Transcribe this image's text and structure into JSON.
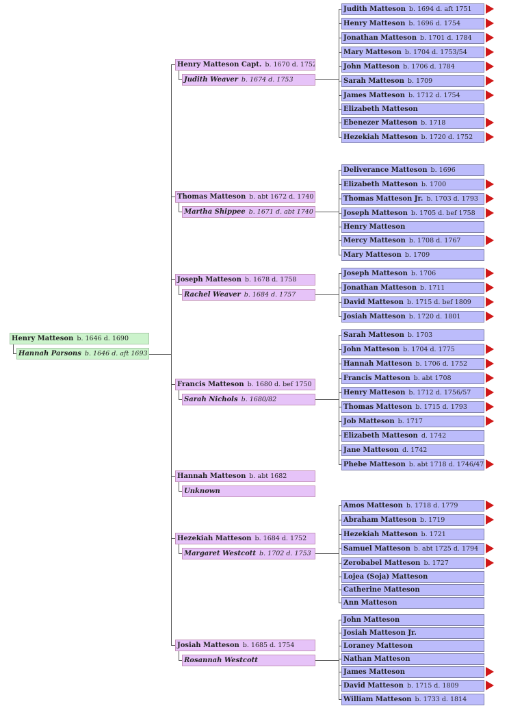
{
  "root": {
    "name": "Henry Matteson",
    "dates": "b. 1646 d. 1690",
    "spouse": "Hannah Parsons",
    "spouse_dates": "b. 1646 d. aft 1693"
  },
  "colors": {
    "root": "#ccf3cc",
    "parent": "#e6c3f8",
    "child": "#bcbcfb",
    "arrow": "#d01818"
  },
  "families": [
    {
      "name": "Henry Matteson Capt.",
      "dates": "b. 1670 d. 1752",
      "spouse": "Judith Weaver",
      "spouse_dates": "b. 1674 d. 1753",
      "children": [
        {
          "name": "Judith Matteson",
          "dates": "b. 1694 d. aft 1751",
          "more": true
        },
        {
          "name": "Henry Matteson",
          "dates": "b. 1696 d. 1754",
          "more": true
        },
        {
          "name": "Jonathan Matteson",
          "dates": "b. 1701 d. 1784",
          "more": true
        },
        {
          "name": "Mary Matteson",
          "dates": "b. 1704 d. 1753/54",
          "more": true
        },
        {
          "name": "John Matteson",
          "dates": "b. 1706 d.  1784",
          "more": true
        },
        {
          "name": "Sarah Matteson",
          "dates": "b. 1709",
          "more": true
        },
        {
          "name": "James Matteson",
          "dates": "b. 1712 d. 1754",
          "more": true
        },
        {
          "name": "Elizabeth Matteson",
          "dates": "",
          "more": false
        },
        {
          "name": "Ebenezer Matteson",
          "dates": "b. 1718",
          "more": true
        },
        {
          "name": "Hezekiah Matteson",
          "dates": "b. 1720 d. 1752",
          "more": true
        }
      ]
    },
    {
      "name": "Thomas Matteson",
      "dates": "b. abt 1672 d. 1740",
      "spouse": "Martha Shippee",
      "spouse_dates": "b. 1671 d. abt 1740",
      "children": [
        {
          "name": "Deliverance Matteson",
          "dates": "b. 1696",
          "more": false
        },
        {
          "name": "Elizabeth Matteson",
          "dates": "b. 1700",
          "more": true
        },
        {
          "name": "Thomas Matteson Jr.",
          "dates": "b. 1703 d. 1793",
          "more": true
        },
        {
          "name": "Joseph Matteson",
          "dates": "b. 1705 d. bef 1758",
          "more": true
        },
        {
          "name": "Henry Matteson",
          "dates": "",
          "more": false
        },
        {
          "name": "Mercy Matteson",
          "dates": "b. 1708 d. 1767",
          "more": true
        },
        {
          "name": "Mary Matteson",
          "dates": "b. 1709",
          "more": false
        }
      ]
    },
    {
      "name": "Joseph Matteson",
      "dates": "b. 1678 d. 1758",
      "spouse": "Rachel Weaver",
      "spouse_dates": "b. 1684 d. 1757",
      "children": [
        {
          "name": "Joseph Matteson",
          "dates": "b. 1706",
          "more": true
        },
        {
          "name": "Jonathan Matteson",
          "dates": "b. 1711",
          "more": true
        },
        {
          "name": "David Matteson",
          "dates": "b. 1715 d. bef 1809",
          "more": true
        },
        {
          "name": "Josiah Matteson",
          "dates": "b. 1720 d. 1801",
          "more": true
        }
      ]
    },
    {
      "name": "Francis Matteson",
      "dates": "b. 1680 d. bef 1750",
      "spouse": "Sarah Nichols",
      "spouse_dates": "b. 1680/82",
      "children": [
        {
          "name": "Sarah Matteson",
          "dates": "b. 1703",
          "more": false
        },
        {
          "name": "John Matteson",
          "dates": "b. 1704 d. 1775",
          "more": true
        },
        {
          "name": "Hannah Matteson",
          "dates": "b. 1706 d. 1752",
          "more": true
        },
        {
          "name": "Francis Matteson",
          "dates": "b. abt 1708",
          "more": true
        },
        {
          "name": "Henry Matteson",
          "dates": "b. 1712 d. 1756/57",
          "more": true
        },
        {
          "name": "Thomas Matteson",
          "dates": "b. 1715 d. 1793",
          "more": true
        },
        {
          "name": "Job Matteson",
          "dates": "b. 1717",
          "more": true
        },
        {
          "name": "Elizabeth Matteson",
          "dates": "d. 1742",
          "more": false
        },
        {
          "name": "Jane Matteson",
          "dates": "d. 1742",
          "more": false
        },
        {
          "name": "Phebe Matteson",
          "dates": "b. abt 1718 d. 1746/47",
          "more": true
        }
      ]
    },
    {
      "name": "Hannah Matteson",
      "dates": "b. abt 1682",
      "spouse": "Unknown",
      "spouse_dates": "",
      "children": []
    },
    {
      "name": "Hezekiah Matteson",
      "dates": "b. 1684 d. 1752",
      "spouse": "Margaret Westcott",
      "spouse_dates": "b. 1702 d. 1753",
      "children": [
        {
          "name": "Amos Matteson",
          "dates": "b. 1718 d. 1779",
          "more": true
        },
        {
          "name": "Abraham Matteson",
          "dates": "b. 1719",
          "more": true
        },
        {
          "name": "Hezekiah Matteson",
          "dates": "b. 1721",
          "more": false
        },
        {
          "name": "Samuel Matteson",
          "dates": "b. abt 1725 d. 1794",
          "more": true
        },
        {
          "name": "Zerobabel Matteson",
          "dates": "b. 1727",
          "more": true
        },
        {
          "name": "Lojea (Soja) Matteson",
          "dates": "",
          "more": false
        },
        {
          "name": "Catherine Matteson",
          "dates": "",
          "more": false
        },
        {
          "name": "Ann Matteson",
          "dates": "",
          "more": false
        }
      ]
    },
    {
      "name": "Josiah Matteson",
      "dates": "b. 1685 d. 1754",
      "spouse": "Rosannah Westcott",
      "spouse_dates": "",
      "children": [
        {
          "name": "John Matteson",
          "dates": "",
          "more": false
        },
        {
          "name": "Josiah Matteson Jr.",
          "dates": "",
          "more": false
        },
        {
          "name": "Loraney Matteson",
          "dates": "",
          "more": false
        },
        {
          "name": "Nathan Matteson",
          "dates": "",
          "more": false
        },
        {
          "name": "James Matteson",
          "dates": "",
          "more": true
        },
        {
          "name": "David Matteson",
          "dates": "b. 1715 d. 1809",
          "more": true
        },
        {
          "name": "William Matteson",
          "dates": "b. 1733 d. 1814",
          "more": false
        }
      ]
    }
  ]
}
